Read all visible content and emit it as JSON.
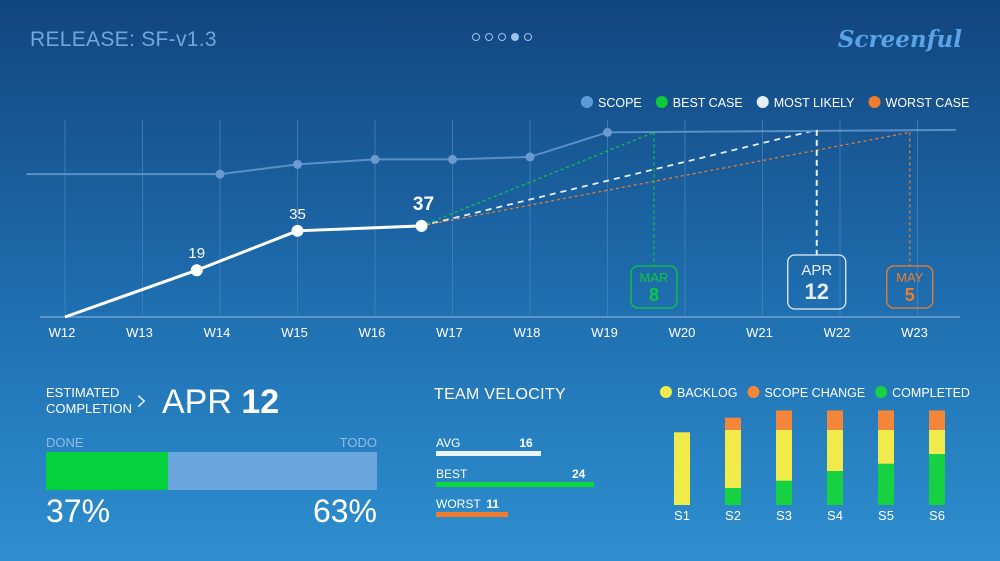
{
  "header": {
    "release_title": "RELEASE: SF-v1.3",
    "logo_text": "Screenful",
    "pager": {
      "count": 5,
      "active_index": 3
    }
  },
  "colors": {
    "scope": "#5b9bd9",
    "best_case": "#0fc93b",
    "most_likely": "#e6eef6",
    "worst_case": "#f07d2a",
    "backlog": "#f0ea4a",
    "scope_change": "#f4863a",
    "completed": "#16d142",
    "avg_bar": "#eaf2fa",
    "best_bar": "#0ad63d",
    "worst_bar": "#f27a2c"
  },
  "chart_data": [
    {
      "type": "line",
      "title": "",
      "categories": [
        "W12",
        "W13",
        "W14",
        "W15",
        "W16",
        "W17",
        "W18",
        "W19",
        "W20",
        "W21",
        "W22",
        "W23"
      ],
      "legend": [
        "SCOPE",
        "BEST CASE",
        "MOST LIKELY",
        "WORST CASE"
      ],
      "legend_position": "top-right",
      "grid": true,
      "series": [
        {
          "name": "SCOPE",
          "points": [
            [
              -0.5,
              58
            ],
            [
              2.0,
              58
            ],
            [
              3.0,
              62
            ],
            [
              4.0,
              64
            ],
            [
              5.0,
              64
            ],
            [
              6.0,
              65
            ],
            [
              7.0,
              75
            ],
            [
              11.5,
              76
            ]
          ]
        },
        {
          "name": "COMPLETED",
          "points": [
            [
              0,
              0
            ],
            [
              1.7,
              19
            ],
            [
              3.0,
              35
            ],
            [
              4.6,
              37
            ]
          ],
          "labels": [
            "",
            "19",
            "35",
            "37"
          ]
        },
        {
          "name": "BEST CASE",
          "from": [
            4.6,
            37
          ],
          "to": [
            7.6,
            75
          ]
        },
        {
          "name": "MOST LIKELY",
          "from": [
            4.6,
            37
          ],
          "to": [
            9.7,
            76
          ]
        },
        {
          "name": "WORST CASE",
          "from": [
            4.6,
            37
          ],
          "to": [
            10.9,
            75
          ]
        }
      ],
      "forecast_markers": [
        {
          "name": "BEST CASE",
          "month": "MAR",
          "day": "8",
          "x": 7.6
        },
        {
          "name": "MOST LIKELY",
          "month": "APR",
          "day": "12",
          "x": 9.7
        },
        {
          "name": "WORST CASE",
          "month": "MAY",
          "day": "5",
          "x": 10.9
        }
      ],
      "ylim": [
        0,
        80
      ]
    },
    {
      "type": "bar",
      "stacked": true,
      "categories": [
        "S1",
        "S2",
        "S3",
        "S4",
        "S5",
        "S6"
      ],
      "legend": [
        "BACKLOG",
        "SCOPE CHANGE",
        "COMPLETED"
      ],
      "series": [
        {
          "name": "COMPLETED",
          "values": [
            0,
            7,
            10,
            14,
            17,
            21
          ]
        },
        {
          "name": "BACKLOG",
          "values": [
            30,
            24,
            21,
            17,
            14,
            10
          ]
        },
        {
          "name": "SCOPE CHANGE",
          "values": [
            0,
            5,
            8,
            8,
            8,
            8
          ]
        }
      ],
      "ylim": [
        0,
        40
      ]
    }
  ],
  "estimate": {
    "label_line1": "ESTIMATED",
    "label_line2": "COMPLETION",
    "chevron": "›",
    "month": "APR",
    "day": "12"
  },
  "progress": {
    "done_label": "DONE",
    "todo_label": "TODO",
    "done_value": 37,
    "todo_value": 63,
    "done_pct": "37",
    "todo_pct": "63",
    "pct_sign": "%"
  },
  "velocity": {
    "title": "TEAM VELOCITY",
    "rows": [
      {
        "name": "AVG",
        "value": "16",
        "num": 16
      },
      {
        "name": "BEST",
        "value": "24",
        "num": 24
      },
      {
        "name": "WORST",
        "value": "11",
        "num": 11
      }
    ],
    "max": 24
  }
}
